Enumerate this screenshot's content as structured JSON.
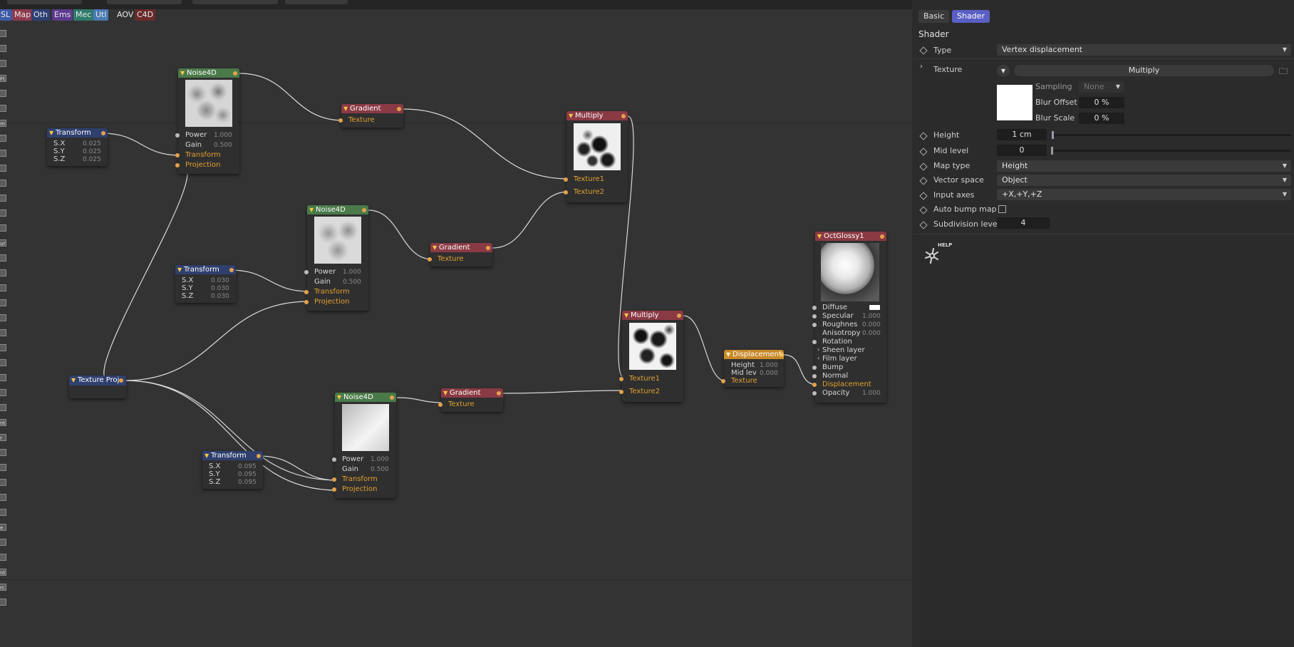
{
  "categories": [
    {
      "label": "SL",
      "color": "#3e5aa8"
    },
    {
      "label": "Map",
      "color": "#8e3a4c"
    },
    {
      "label": "Oth",
      "color": "#2d3f72"
    },
    {
      "label": "Ems",
      "color": "#5c3a8e"
    },
    {
      "label": "Mec",
      "color": "#2f7a6a"
    },
    {
      "label": "Utl",
      "color": "#4a7ab4"
    },
    {
      "label": "AOV",
      "color": "#333333"
    },
    {
      "label": "C4D",
      "color": "#6a2a2a"
    }
  ],
  "left_strip": {
    "labels": [
      "",
      "",
      "",
      "Ft",
      "",
      "",
      "m",
      "",
      "",
      "",
      "",
      "",
      "",
      "",
      "ur",
      "",
      "",
      "",
      "",
      "",
      "",
      "",
      "",
      "",
      "",
      "",
      "nt",
      "r",
      "",
      "",
      "",
      "",
      "",
      "e",
      "",
      "",
      "nt",
      "rc",
      ""
    ]
  },
  "nodes": {
    "noise1": {
      "title": "Noise4D",
      "power_label": "Power",
      "power": "1.000",
      "gain_label": "Gain",
      "gain": "0.500",
      "transform": "Transform",
      "projection": "Projection"
    },
    "noise2": {
      "title": "Noise4D",
      "power_label": "Power",
      "power": "1.000",
      "gain_label": "Gain",
      "gain": "0.500",
      "transform": "Transform",
      "projection": "Projection"
    },
    "noise3": {
      "title": "Noise4D",
      "power_label": "Power",
      "power": "1.000",
      "gain_label": "Gain",
      "gain": "0.500",
      "transform": "Transform",
      "projection": "Projection"
    },
    "transform1": {
      "title": "Transform",
      "sx_label": "S.X",
      "sx": "0.025",
      "sy_label": "S.Y",
      "sy": "0.025",
      "sz_label": "S.Z",
      "sz": "0.025"
    },
    "transform2": {
      "title": "Transform",
      "sx_label": "S.X",
      "sx": "0.030",
      "sy_label": "S.Y",
      "sy": "0.030",
      "sz_label": "S.Z",
      "sz": "0.030"
    },
    "transform3": {
      "title": "Transform",
      "sx_label": "S.X",
      "sx": "0.095",
      "sy_label": "S.Y",
      "sy": "0.095",
      "sz_label": "S.Z",
      "sz": "0.095"
    },
    "gradient1": {
      "title": "Gradient",
      "texture": "Texture"
    },
    "gradient2": {
      "title": "Gradient",
      "texture": "Texture"
    },
    "gradient3": {
      "title": "Gradient",
      "texture": "Texture"
    },
    "multiply1": {
      "title": "Multiply",
      "t1": "Texture1",
      "t2": "Texture2"
    },
    "multiply2": {
      "title": "Multiply",
      "t1": "Texture1",
      "t2": "Texture2"
    },
    "texproj": {
      "title": "Texture Proj"
    },
    "displacement": {
      "title": "Displacement",
      "height_label": "Height",
      "height": "1.000",
      "mid_label": "Mid lev",
      "mid": "0.000",
      "texture": "Texture"
    },
    "glossy": {
      "title": "OctGlossy1",
      "diffuse": "Diffuse",
      "specular": "Specular",
      "specular_val": "1.000",
      "roughness": "Roughness",
      "roughness_val": "0.000",
      "anisotropy": "Anisotropy",
      "anisotropy_val": "0.000",
      "rotation": "Rotation",
      "sheen": "Sheen layer",
      "film": "Film layer",
      "bump": "Bump",
      "normal": "Normal",
      "displacement": "Displacement",
      "opacity": "Opacity",
      "opacity_val": "1.000"
    }
  },
  "panel": {
    "tabs": {
      "basic": "Basic",
      "shader": "Shader"
    },
    "section": "Shader",
    "type_label": "Type",
    "type_value": "Vertex displacement",
    "texture_label": "Texture",
    "texture_value": "Multiply",
    "sampling_label": "Sampling",
    "sampling_value": "None",
    "blur_offset_label": "Blur Offset",
    "blur_offset_value": "0 %",
    "blur_scale_label": "Blur Scale",
    "blur_scale_value": "0 %",
    "height_label": "Height",
    "height_value": "1 cm",
    "mid_label": "Mid level",
    "mid_value": "0",
    "maptype_label": "Map type",
    "maptype_value": "Height",
    "vector_label": "Vector space",
    "vector_value": "Object",
    "axes_label": "Input axes",
    "axes_value": "+X,+Y,+Z",
    "autobump_label": "Auto bump map",
    "subdiv_label": "Subdivision level",
    "subdiv_value": "4",
    "help_label": "HELP"
  },
  "colors": {
    "accent": "#5a5fc4",
    "port": "#e3a24a",
    "wire": "#d8d8d8"
  }
}
